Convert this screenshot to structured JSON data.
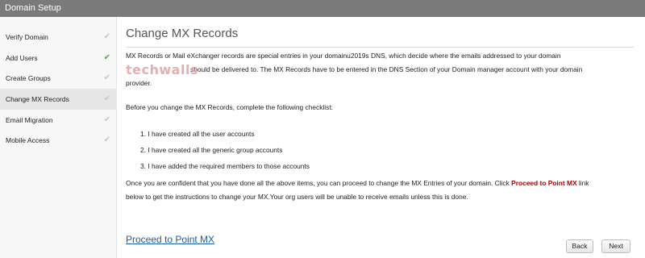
{
  "window": {
    "title": "Domain Setup"
  },
  "sidebar": {
    "items": [
      {
        "label": "Verify Domain",
        "check": "✔",
        "done": false
      },
      {
        "label": "Add Users",
        "check": "✔",
        "done": true
      },
      {
        "label": "Create Groups",
        "check": "✔",
        "done": false
      },
      {
        "label": "Change MX Records",
        "check": "✔",
        "done": false
      },
      {
        "label": "Email Migration",
        "check": "✔",
        "done": false
      },
      {
        "label": "Mobile Access",
        "check": "✔",
        "done": false
      }
    ],
    "active_index": 3
  },
  "main": {
    "heading": "Change MX Records",
    "intro_line1": "MX Records or Mail eXchanger records are special entries in your domainu2019s DNS, which decide where the emails addressed to your domain",
    "intro_line2": "should be delivered to. The MX Records have to be entered in the DNS Section of your Domain manager account with your domain",
    "intro_line3": "provider.",
    "checklist_intro": "Before you change the MX Records, complete the following checklist:",
    "checklist": [
      "1.  I have created all the user accounts",
      "2.  I have created all the generic group accounts",
      "3.  I have added the required members to those accounts"
    ],
    "confident_part1": "Once you are confident that you have done all the above items, you can proceed to change the MX Entries of your domain. Click",
    "confident_link": "Proceed to Point MX",
    "confident_part2": "link",
    "confident_line2": "below to get the instructions to change your MX.Your org users will be unable to receive emails unless this is done.",
    "proceed_link": "Proceed to Point MX"
  },
  "watermark": {
    "text": "techwalls"
  },
  "buttons": {
    "back": "Back",
    "next": "Next"
  }
}
